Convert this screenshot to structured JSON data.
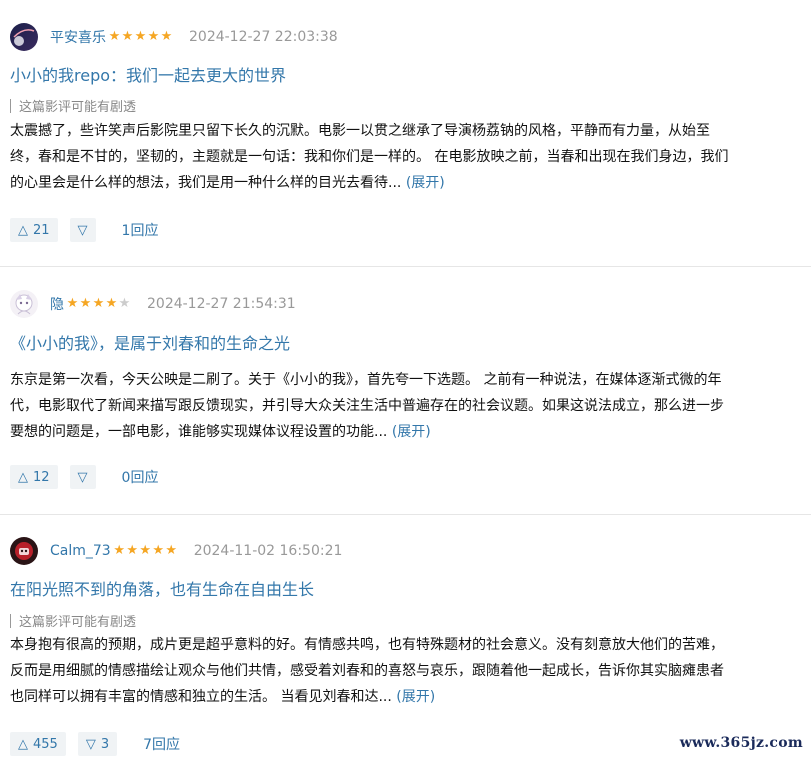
{
  "reviews": [
    {
      "username": "平安喜乐",
      "rating": 5,
      "date": "2024-12-27 22:03:38",
      "title": "小小的我repo：我们一起去更大的世界",
      "spoiler_notice": "这篇影评可能有剧透",
      "body_lines": [
        "太震撼了，些许笑声后影院里只留下长久的沉默。电影一以贯之继承了导演杨荔钠的风格，平静而有力量，从始至",
        "终，春和是不甘的，坚韧的，主题就是一句话：我和你们是一样的。 在电影放映之前，当春和出现在我们身边，我们",
        "的心里会是什么样的想法，我们是用一种什么样的目光去看待..."
      ],
      "expand_label": "(展开)",
      "upvotes": "21",
      "downvotes": "",
      "replies": "1回应"
    },
    {
      "username": "隐",
      "rating": 4,
      "date": "2024-12-27 21:54:31",
      "title": "《小小的我》，是属于刘春和的生命之光",
      "spoiler_notice": "",
      "body_lines": [
        "东京是第一次看，今天公映是二刷了。关于《小小的我》，首先夸一下选题。 之前有一种说法，在媒体逐渐式微的年",
        "代，电影取代了新闻来描写跟反馈现实，并引导大众关注生活中普遍存在的社会议题。如果这说法成立，那么进一步",
        "要想的问题是，一部电影，谁能够实现媒体议程设置的功能..."
      ],
      "expand_label": "(展开)",
      "upvotes": "12",
      "downvotes": "",
      "replies": "0回应"
    },
    {
      "username": "Calm_73",
      "rating": 5,
      "date": "2024-11-02 16:50:21",
      "title": "在阳光照不到的角落，也有生命在自由生长",
      "spoiler_notice": "这篇影评可能有剧透",
      "body_lines": [
        "本身抱有很高的预期，成片更是超乎意料的好。有情感共鸣，也有特殊题材的社会意义。没有刻意放大他们的苦难，",
        "反而是用细腻的情感描绘让观众与他们共情，感受着刘春和的喜怒与哀乐，跟随着他一起成长，告诉你其实脑瘫患者",
        "也同样可以拥有丰富的情感和独立的生活。 当看见刘春和达..."
      ],
      "expand_label": "(展开)",
      "upvotes": "455",
      "downvotes": "3",
      "replies": "7回应"
    }
  ],
  "icons": {
    "up": "△",
    "down": "▽",
    "star": "★"
  },
  "colors": {
    "link": "#3377aa",
    "star": "#f5a623",
    "meta": "#999999"
  },
  "watermark": "www.365jz.com"
}
